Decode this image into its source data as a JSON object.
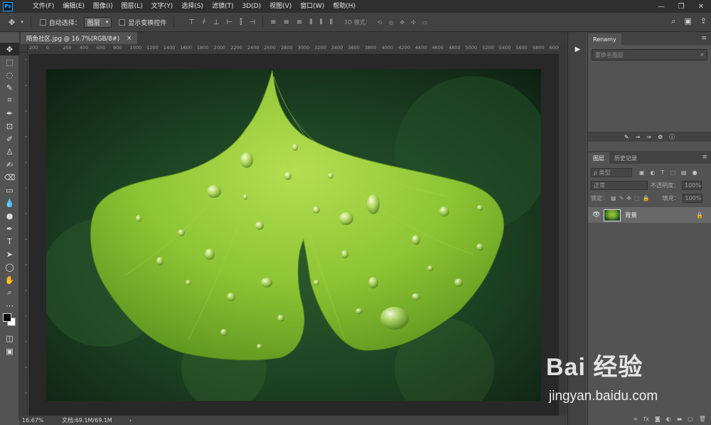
{
  "app": {
    "logo": "Ps"
  },
  "menu": [
    "文件(F)",
    "编辑(E)",
    "图像(I)",
    "图层(L)",
    "文字(Y)",
    "选择(S)",
    "滤镜(T)",
    "3D(D)",
    "视图(V)",
    "窗口(W)",
    "帮助(H)"
  ],
  "window_controls": {
    "minimize": "—",
    "restore": "❐",
    "close": "✕"
  },
  "options": {
    "auto_select_label": "自动选择：",
    "auto_select_value": "图层",
    "show_transform_label": "显示变换控件",
    "mode3d_label": "3D 模式："
  },
  "document": {
    "tab_title": "陌鱼社区.jpg @ 16.7%(RGB/8#)",
    "tab_close": "×",
    "zoom": "16.67%",
    "doc_size": "文档:69.1M/69.1M",
    "status_arrow": "›"
  },
  "ruler": {
    "h_ticks": [
      "200",
      "0",
      "200",
      "400",
      "600",
      "800",
      "1000",
      "1200",
      "1400",
      "1600",
      "1800",
      "2000",
      "2200",
      "2400",
      "2600",
      "2800",
      "3000",
      "3200",
      "3400",
      "3600",
      "3800",
      "4000",
      "4200",
      "4400",
      "4600",
      "4800",
      "5000",
      "5200",
      "5400",
      "5600",
      "5800",
      "6000"
    ]
  },
  "panels": {
    "renamy": {
      "tab": "Renamy",
      "search_placeholder": "重命名图层"
    },
    "layers": {
      "tabs": [
        "图层",
        "历史记录"
      ],
      "filter_kind": "ρ 类型",
      "blend_mode": "正常",
      "opacity_label": "不透明度：",
      "opacity_value": "100%",
      "lock_label": "锁定：",
      "fill_label": "填充：",
      "fill_value": "100%",
      "layer_name": "背景"
    }
  },
  "watermark": {
    "brand": "Bai 经验",
    "url": "jingyan.baidu.com"
  },
  "colors": {
    "accent": "#31a8ff",
    "leaf": "#8cc33a",
    "bg_dark": "#1e3d22"
  }
}
